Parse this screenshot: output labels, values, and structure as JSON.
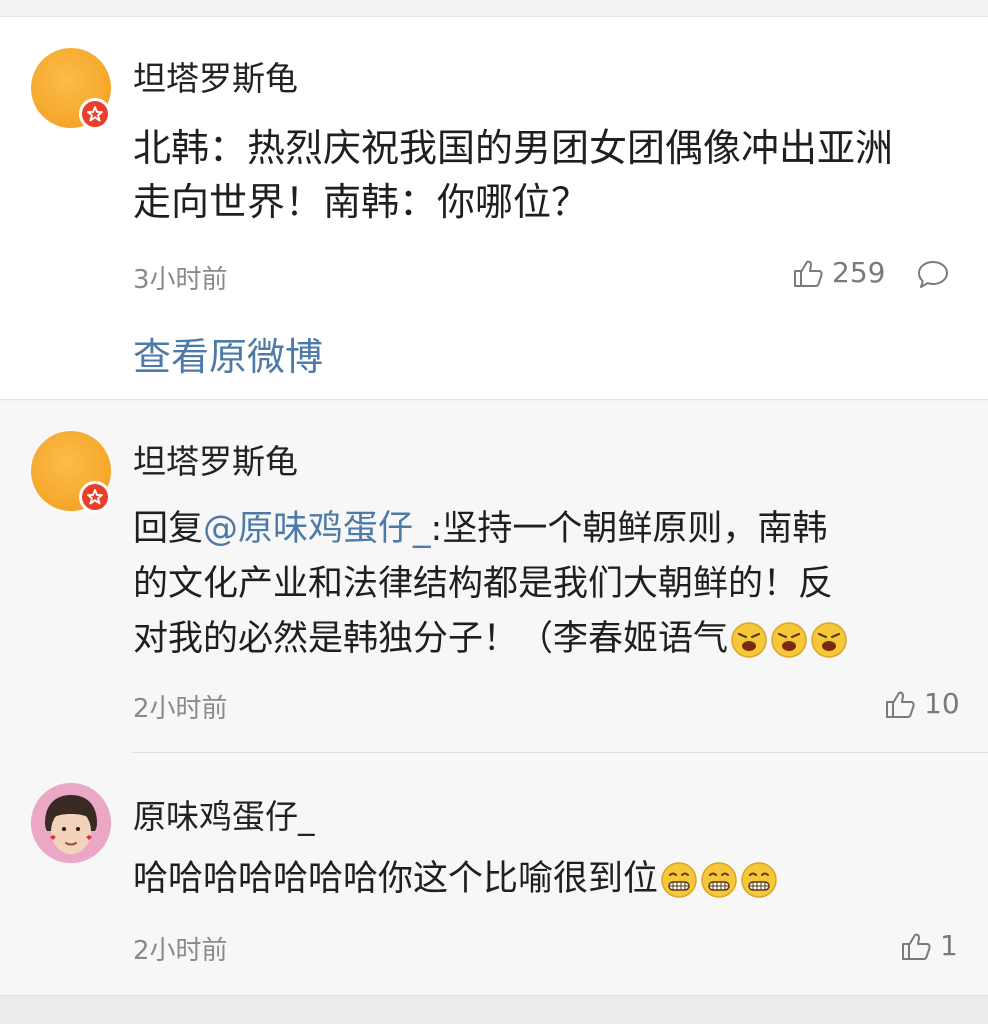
{
  "main_post": {
    "author": "坦塔罗斯龟",
    "text_line1": "北韩：热烈庆祝我国的男团女团偶像冲出亚洲",
    "text_line2": "走向世界！南韩：你哪位？",
    "time": "3小时前",
    "likes": "259",
    "view_original": "查看原微博"
  },
  "replies": [
    {
      "author": "坦塔罗斯龟",
      "prefix": "回复",
      "mention": "@原味鸡蛋仔_",
      "line1_rest": ":坚持一个朝鲜原则，南韩",
      "line2": "的文化产业和法律结构都是我们大朝鲜的！反",
      "line3": "对我的必然是韩独分子！（李春姬语气",
      "emoji": "angry-face",
      "time": "2小时前",
      "likes": "10"
    },
    {
      "author": "原味鸡蛋仔_",
      "text": "哈哈哈哈哈哈哈你这个比喻很到位",
      "emoji": "grinning-face",
      "time": "2小时前",
      "likes": "1"
    }
  ],
  "colors": {
    "link": "#4e7aa8",
    "badge": "#e8402c",
    "avatar": "#f6a62a"
  }
}
